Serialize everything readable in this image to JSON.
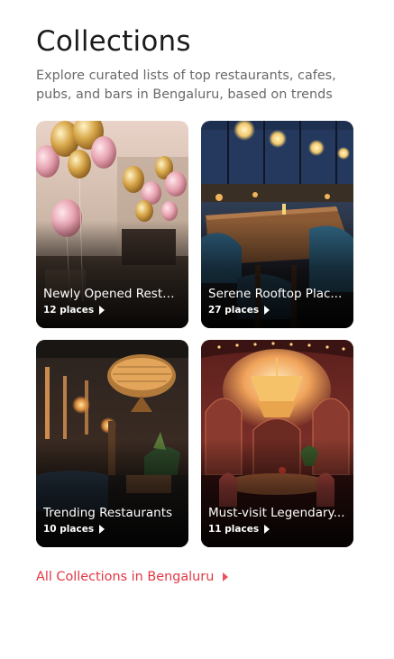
{
  "header": {
    "title": "Collections",
    "subtitle": "Explore curated lists of top restaurants, cafes, pubs, and bars in Bengaluru, based on trends"
  },
  "collections": [
    {
      "title": "Newly Opened Resta...",
      "places": "12 places",
      "image": "balloons-restaurant-photo"
    },
    {
      "title": "Serene Rooftop Plac...",
      "places": "27 places",
      "image": "rooftop-dining-photo"
    },
    {
      "title": "Trending Restaurants",
      "places": "10 places",
      "image": "lounge-chandelier-photo"
    },
    {
      "title": "Must-visit Legendary...",
      "places": "11 places",
      "image": "ornate-dining-hall-photo"
    }
  ],
  "footer_link": {
    "label": "All Collections in Bengaluru"
  },
  "colors": {
    "accent": "#e23744",
    "title": "#1c1c1c",
    "subtitle": "#696969"
  },
  "icons": {
    "places_arrow": "play-triangle-icon",
    "link_arrow": "caret-right-icon"
  }
}
